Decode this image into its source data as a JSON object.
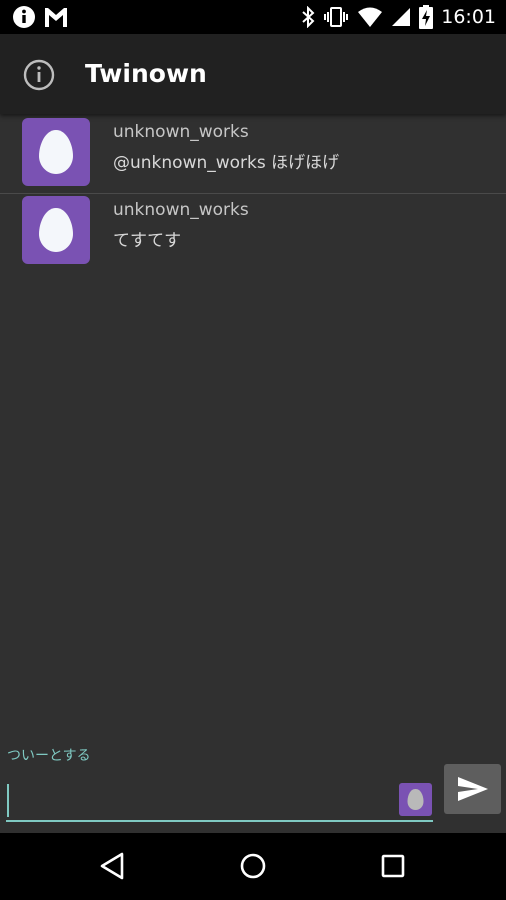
{
  "status_bar": {
    "time": "16:01",
    "icons": [
      "info-icon",
      "gmail-icon",
      "bluetooth-icon",
      "vibrate-icon",
      "wifi-icon",
      "signal-icon",
      "battery-charging-icon"
    ]
  },
  "app_bar": {
    "title": "Twinown",
    "info_icon": "info-outline-icon"
  },
  "timeline": {
    "tweets": [
      {
        "name": "unknown_works",
        "text": "@unknown_works ほげほげ",
        "avatar": "egg-avatar-icon"
      },
      {
        "name": "unknown_works",
        "text": "てすてす",
        "avatar": "egg-avatar-icon"
      }
    ]
  },
  "compose": {
    "hint": "ついーとする",
    "value": "",
    "send_icon": "send-icon",
    "accent_color": "#7fc9c2"
  },
  "nav_bar": {
    "buttons": [
      "back-icon",
      "home-icon",
      "recents-icon"
    ]
  },
  "colors": {
    "background": "#303030",
    "app_bar": "#212121",
    "avatar": "#7a52b3",
    "accent": "#7fc9c2"
  }
}
